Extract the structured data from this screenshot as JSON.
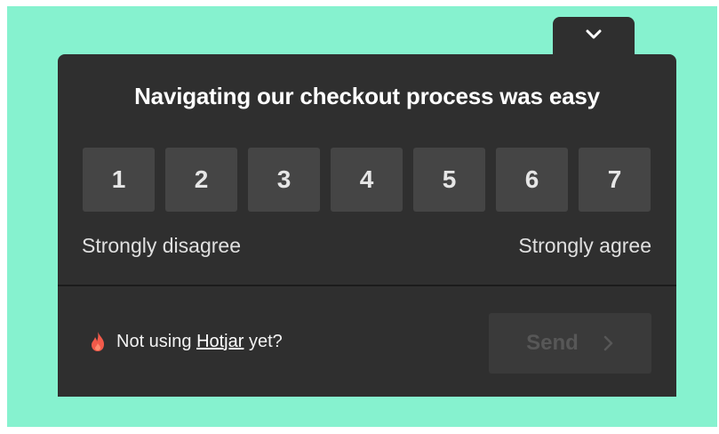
{
  "colors": {
    "background": "#86f2cf",
    "panel": "#2f2f2f",
    "scale_button": "#454545",
    "send_button": "#3a3a3a",
    "send_text": "#575757",
    "flame": "#f25a4a"
  },
  "survey": {
    "question": "Navigating our checkout process was easy",
    "scale_options": [
      "1",
      "2",
      "3",
      "4",
      "5",
      "6",
      "7"
    ],
    "label_low": "Strongly disagree",
    "label_high": "Strongly agree"
  },
  "footer": {
    "brand_icon": "hotjar-flame-icon",
    "text_before": "Not using",
    "link_text": "Hotjar",
    "text_after": "yet?",
    "send_label": "Send",
    "send_icon": "chevron-right-icon"
  },
  "minimize_icon": "chevron-down-icon"
}
